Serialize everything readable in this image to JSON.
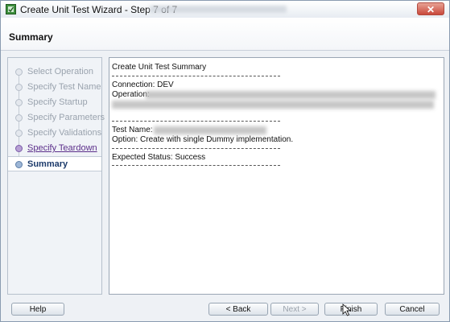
{
  "window": {
    "title": "Create Unit Test Wizard - Step 7 of 7",
    "close_glyph": "✕"
  },
  "header": {
    "title": "Summary"
  },
  "nav": {
    "items": [
      {
        "label": "Select Operation",
        "state": "inactive"
      },
      {
        "label": "Specify Test Name",
        "state": "inactive"
      },
      {
        "label": "Specify Startup",
        "state": "inactive"
      },
      {
        "label": "Specify Parameters",
        "state": "inactive"
      },
      {
        "label": "Specify Validations",
        "state": "inactive"
      },
      {
        "label": "Specify Teardown",
        "state": "done"
      },
      {
        "label": "Summary",
        "state": "active"
      }
    ]
  },
  "summary": {
    "heading": "Create Unit Test Summary",
    "connection": "Connection: DEV",
    "operation_label": "Operation:",
    "test_name_label": "Test Name:",
    "option": "Option: Create with single Dummy implementation.",
    "expected_status": "Expected Status: Success"
  },
  "buttons": {
    "help": "Help",
    "back": "< Back",
    "next": "Next >",
    "finish": "Finish",
    "cancel": "Cancel"
  }
}
